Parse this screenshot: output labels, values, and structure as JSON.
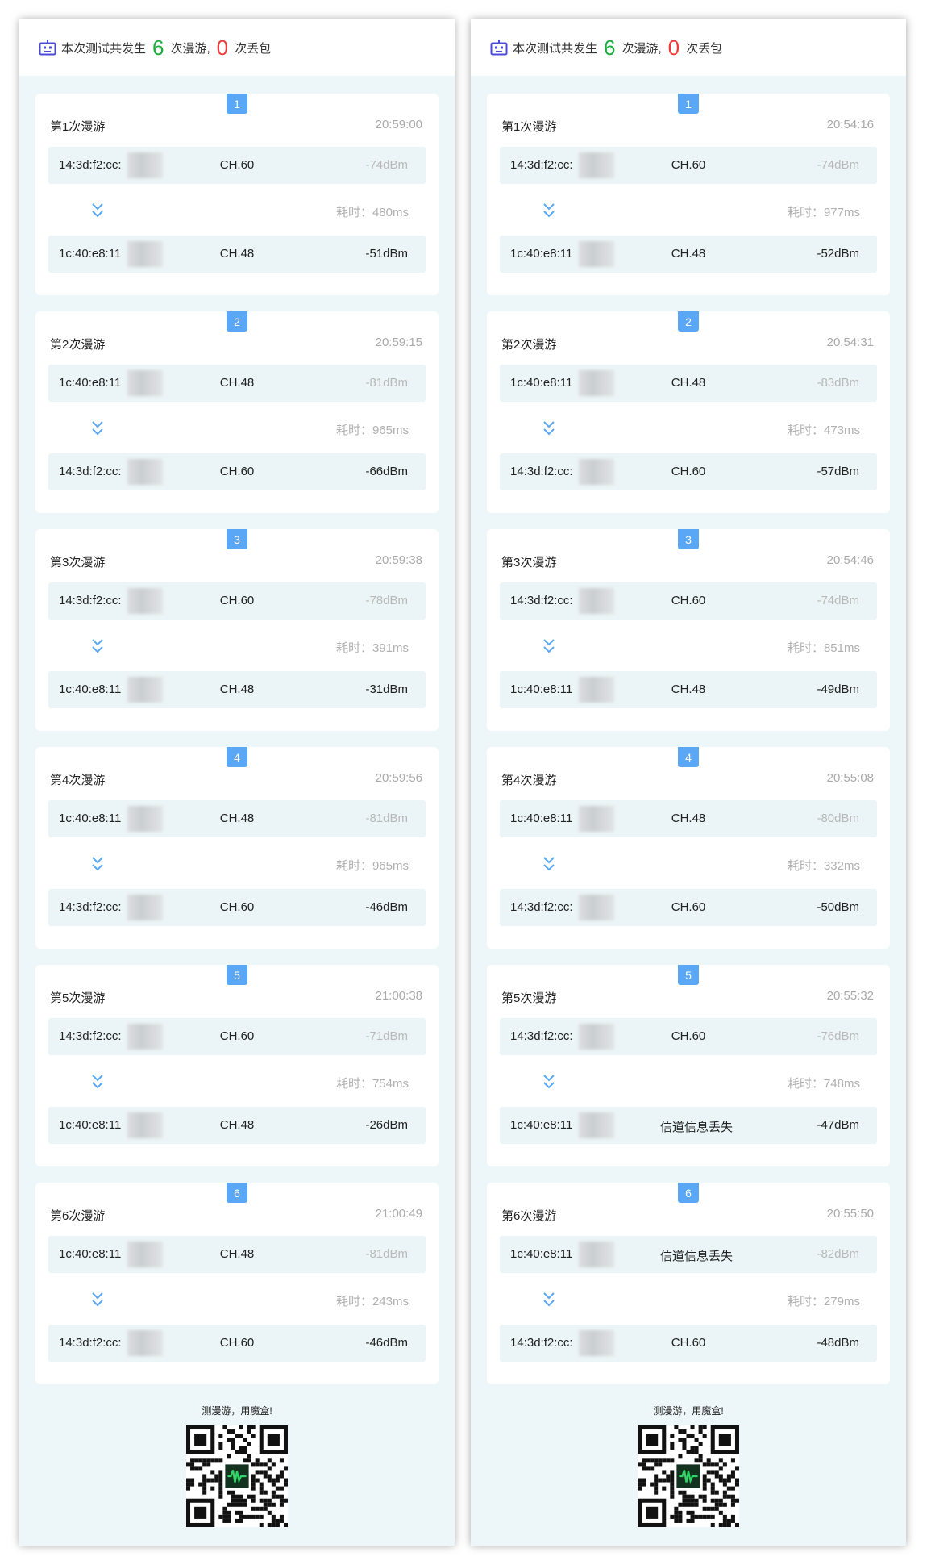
{
  "panels": [
    {
      "summary": {
        "prefix": "本次测试共发生",
        "roam_count": "6",
        "roam_label": "次漫游,",
        "loss_count": "0",
        "loss_label": "次丢包"
      },
      "cards": [
        {
          "badge": "1",
          "title": "第1次漫游",
          "time": "20:59:00",
          "from": {
            "mac": "14:3d:f2:cc:",
            "ch": "CH.60",
            "signal": "-74dBm"
          },
          "cost": "耗时：480ms",
          "to": {
            "mac": "1c:40:e8:11",
            "ch": "CH.48",
            "signal": "-51dBm"
          }
        },
        {
          "badge": "2",
          "title": "第2次漫游",
          "time": "20:59:15",
          "from": {
            "mac": "1c:40:e8:11",
            "ch": "CH.48",
            "signal": "-81dBm"
          },
          "cost": "耗时：965ms",
          "to": {
            "mac": "14:3d:f2:cc:",
            "ch": "CH.60",
            "signal": "-66dBm"
          }
        },
        {
          "badge": "3",
          "title": "第3次漫游",
          "time": "20:59:38",
          "from": {
            "mac": "14:3d:f2:cc:",
            "ch": "CH.60",
            "signal": "-78dBm"
          },
          "cost": "耗时：391ms",
          "to": {
            "mac": "1c:40:e8:11",
            "ch": "CH.48",
            "signal": "-31dBm"
          }
        },
        {
          "badge": "4",
          "title": "第4次漫游",
          "time": "20:59:56",
          "from": {
            "mac": "1c:40:e8:11",
            "ch": "CH.48",
            "signal": "-81dBm"
          },
          "cost": "耗时：965ms",
          "to": {
            "mac": "14:3d:f2:cc:",
            "ch": "CH.60",
            "signal": "-46dBm"
          }
        },
        {
          "badge": "5",
          "title": "第5次漫游",
          "time": "21:00:38",
          "from": {
            "mac": "14:3d:f2:cc:",
            "ch": "CH.60",
            "signal": "-71dBm"
          },
          "cost": "耗时：754ms",
          "to": {
            "mac": "1c:40:e8:11",
            "ch": "CH.48",
            "signal": "-26dBm"
          }
        },
        {
          "badge": "6",
          "title": "第6次漫游",
          "time": "21:00:49",
          "from": {
            "mac": "1c:40:e8:11",
            "ch": "CH.48",
            "signal": "-81dBm"
          },
          "cost": "耗时：243ms",
          "to": {
            "mac": "14:3d:f2:cc:",
            "ch": "CH.60",
            "signal": "-46dBm"
          }
        }
      ],
      "footer": {
        "slogan": "测漫游，用魔盒!"
      }
    },
    {
      "summary": {
        "prefix": "本次测试共发生",
        "roam_count": "6",
        "roam_label": "次漫游,",
        "loss_count": "0",
        "loss_label": "次丢包"
      },
      "cards": [
        {
          "badge": "1",
          "title": "第1次漫游",
          "time": "20:54:16",
          "from": {
            "mac": "14:3d:f2:cc:",
            "ch": "CH.60",
            "signal": "-74dBm"
          },
          "cost": "耗时：977ms",
          "to": {
            "mac": "1c:40:e8:11",
            "ch": "CH.48",
            "signal": "-52dBm"
          }
        },
        {
          "badge": "2",
          "title": "第2次漫游",
          "time": "20:54:31",
          "from": {
            "mac": "1c:40:e8:11",
            "ch": "CH.48",
            "signal": "-83dBm"
          },
          "cost": "耗时：473ms",
          "to": {
            "mac": "14:3d:f2:cc:",
            "ch": "CH.60",
            "signal": "-57dBm"
          }
        },
        {
          "badge": "3",
          "title": "第3次漫游",
          "time": "20:54:46",
          "from": {
            "mac": "14:3d:f2:cc:",
            "ch": "CH.60",
            "signal": "-74dBm"
          },
          "cost": "耗时：851ms",
          "to": {
            "mac": "1c:40:e8:11",
            "ch": "CH.48",
            "signal": "-49dBm"
          }
        },
        {
          "badge": "4",
          "title": "第4次漫游",
          "time": "20:55:08",
          "from": {
            "mac": "1c:40:e8:11",
            "ch": "CH.48",
            "signal": "-80dBm"
          },
          "cost": "耗时：332ms",
          "to": {
            "mac": "14:3d:f2:cc:",
            "ch": "CH.60",
            "signal": "-50dBm"
          }
        },
        {
          "badge": "5",
          "title": "第5次漫游",
          "time": "20:55:32",
          "from": {
            "mac": "14:3d:f2:cc:",
            "ch": "CH.60",
            "signal": "-76dBm"
          },
          "cost": "耗时：748ms",
          "to": {
            "mac": "1c:40:e8:11",
            "ch": "信道信息丢失",
            "signal": "-47dBm"
          }
        },
        {
          "badge": "6",
          "title": "第6次漫游",
          "time": "20:55:50",
          "from": {
            "mac": "1c:40:e8:11",
            "ch": "信道信息丢失",
            "signal": "-82dBm"
          },
          "cost": "耗时：279ms",
          "to": {
            "mac": "14:3d:f2:cc:",
            "ch": "CH.60",
            "signal": "-48dBm"
          }
        }
      ],
      "footer": {
        "slogan": "测漫游，用魔盒!"
      }
    }
  ],
  "colors": {
    "roam_count": "#1aad3f",
    "loss_count": "#ef3a3a",
    "badge": "#5aa7f5",
    "arrow": "#5aa7f5"
  },
  "icons": {
    "header": "robot-icon",
    "transition": "double-chevron-down-icon",
    "footer": "qr-code-icon"
  }
}
